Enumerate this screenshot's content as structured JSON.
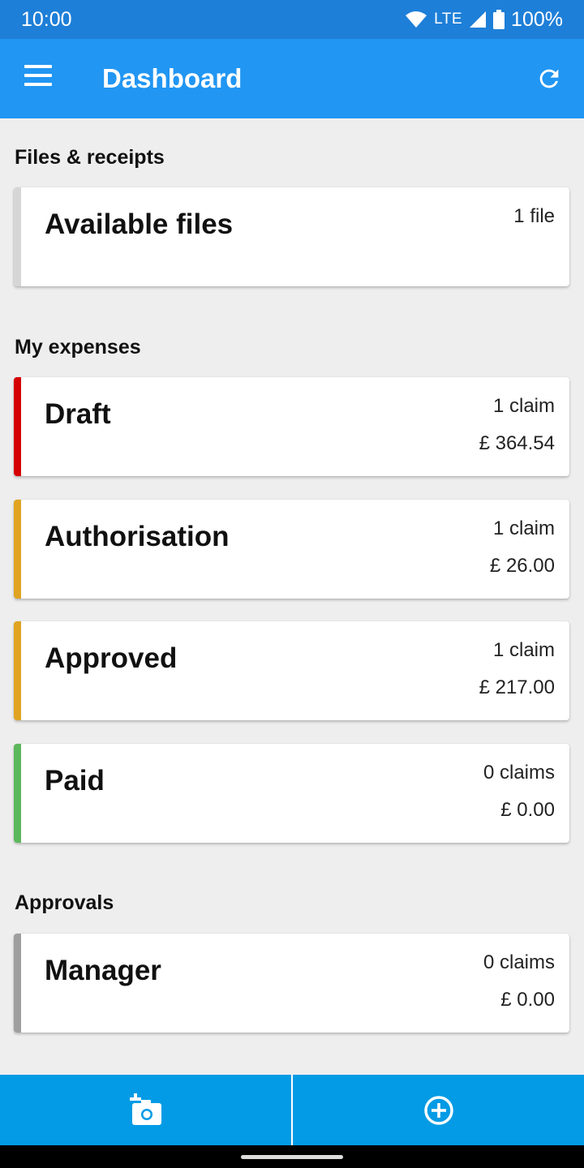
{
  "status_bar": {
    "time": "10:00",
    "network": "LTE",
    "battery": "100%"
  },
  "app_bar": {
    "title": "Dashboard",
    "background": "#2196f3"
  },
  "sections": {
    "files": {
      "label": "Files & receipts",
      "cards": [
        {
          "title": "Available files",
          "count": "1 file",
          "color": "#d6d6d6"
        }
      ]
    },
    "expenses": {
      "label": "My expenses",
      "cards": [
        {
          "title": "Draft",
          "count": "1 claim",
          "amount": "£ 364.54",
          "color": "#d50000"
        },
        {
          "title": "Authorisation",
          "count": "1 claim",
          "amount": "£ 26.00",
          "color": "#e0a422"
        },
        {
          "title": "Approved",
          "count": "1 claim",
          "amount": "£ 217.00",
          "color": "#e0a422"
        },
        {
          "title": "Paid",
          "count": "0 claims",
          "amount": "£ 0.00",
          "color": "#5cb85c"
        }
      ]
    },
    "approvals": {
      "label": "Approvals",
      "cards": [
        {
          "title": "Manager",
          "count": "0 claims",
          "amount": "£ 0.00",
          "color": "#9e9e9e"
        }
      ]
    }
  },
  "bottom_bar": {
    "left_icon": "add-photo-icon",
    "right_icon": "add-circle-icon",
    "background": "#039be5"
  }
}
